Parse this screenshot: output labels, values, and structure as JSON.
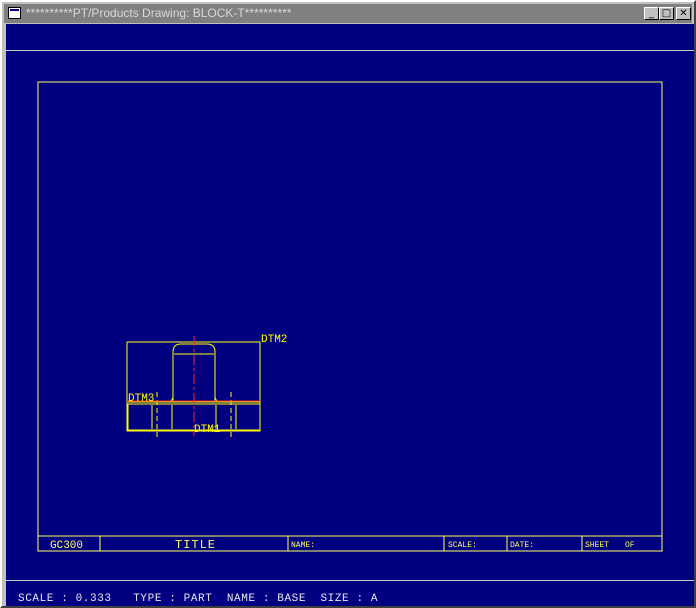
{
  "window": {
    "title": "**********PT/Products Drawing: BLOCK-T**********",
    "minimize_glyph": "_",
    "maximize_glyph": "□",
    "close_glyph": "✕"
  },
  "drawing": {
    "datums": {
      "top": "DTM2",
      "left": "DTM3",
      "bottom": "DTM1"
    },
    "title_block": {
      "part_number": "GC300",
      "title": "TITLE",
      "name": "NAME:",
      "scale": "SCALE:",
      "date": "DATE:",
      "sheet": "SHEET",
      "of": "OF"
    }
  },
  "status": "SCALE : 0.333   TYPE : PART  NAME : BASE  SIZE : A",
  "colors": {
    "background": "#000080",
    "drawing_lines": "#ffff00",
    "centerline": "#ff2020",
    "border": "#ffff60"
  }
}
